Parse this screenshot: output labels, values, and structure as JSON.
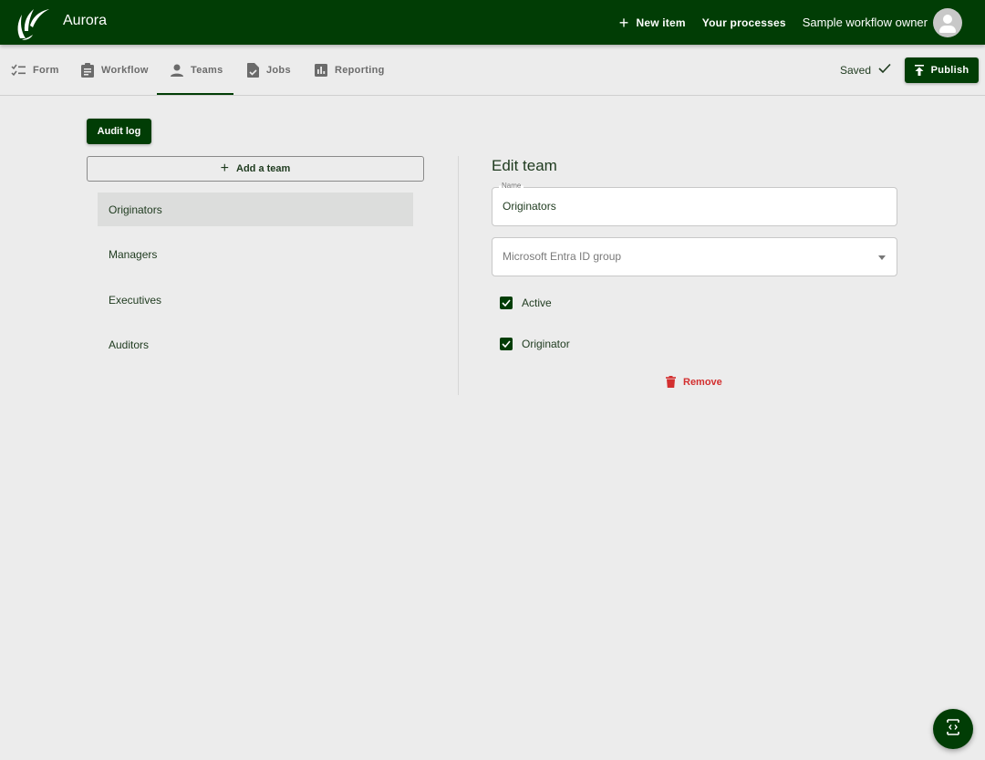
{
  "app": {
    "title": "Aurora",
    "logo_icon": "leaf-swoosh-logo",
    "brand_color": "#013d05"
  },
  "header": {
    "new_item_label": "New item",
    "your_processes_label": "Your processes",
    "owner_name": "Sample workflow owner",
    "avatar_icon": "person-icon"
  },
  "tabs": [
    {
      "label": "Form",
      "icon": "checklist-icon",
      "active": false
    },
    {
      "label": "Workflow",
      "icon": "clipboard-icon",
      "active": false
    },
    {
      "label": "Teams",
      "icon": "person-icon",
      "active": true
    },
    {
      "label": "Jobs",
      "icon": "file-check-icon",
      "active": false
    },
    {
      "label": "Reporting",
      "icon": "bar-chart-icon",
      "active": false
    }
  ],
  "status": {
    "saved_label": "Saved",
    "publish_label": "Publish"
  },
  "left_panel": {
    "audit_log_label": "Audit log",
    "add_team_label": "Add a team",
    "teams": [
      {
        "name": "Originators",
        "selected": true
      },
      {
        "name": "Managers",
        "selected": false
      },
      {
        "name": "Executives",
        "selected": false
      },
      {
        "name": "Auditors",
        "selected": false
      }
    ]
  },
  "edit_team": {
    "title": "Edit team",
    "name_label": "Name",
    "name_value": "Originators",
    "group_placeholder": "Microsoft Entra ID group",
    "checkboxes": [
      {
        "label": "Active",
        "checked": true
      },
      {
        "label": "Originator",
        "checked": true
      }
    ],
    "remove_label": "Remove",
    "remove_color": "#d32f2f"
  },
  "fab": {
    "icon": "code-bracket-icon"
  }
}
